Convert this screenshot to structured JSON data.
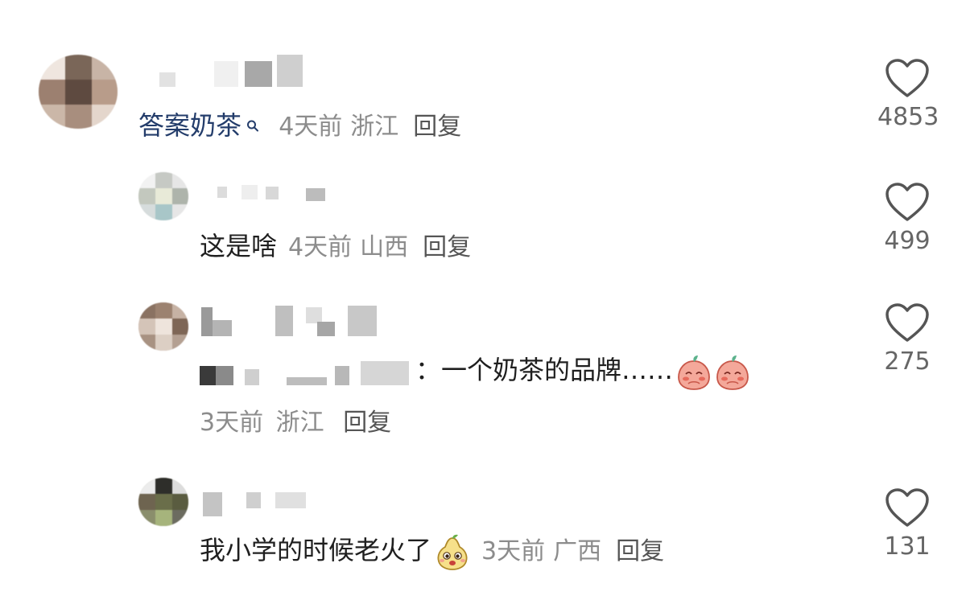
{
  "comments": [
    {
      "text": "",
      "link_text": "答案奶茶",
      "time": "4天前",
      "location": "浙江",
      "reply_label": "回复",
      "likes": "4853"
    },
    {
      "text": "这是啥",
      "time": "4天前",
      "location": "山西",
      "reply_label": "回复",
      "likes": "499"
    },
    {
      "text": "：一个奶茶的品牌……",
      "time": "3天前",
      "location": "浙江",
      "reply_label": "回复",
      "likes": "275"
    },
    {
      "text": "我小学的时候老火了",
      "time": "3天前",
      "location": "广西",
      "reply_label": "回复",
      "likes": "131"
    }
  ],
  "icons": {
    "like": "heart-outline-icon",
    "search": "search-icon",
    "emoji_shy": "shy-peach-emoji",
    "emoji_pear": "pear-face-emoji"
  },
  "colors": {
    "link": "#243d6b",
    "meta": "#8c8c8c",
    "heart": "#555555"
  }
}
